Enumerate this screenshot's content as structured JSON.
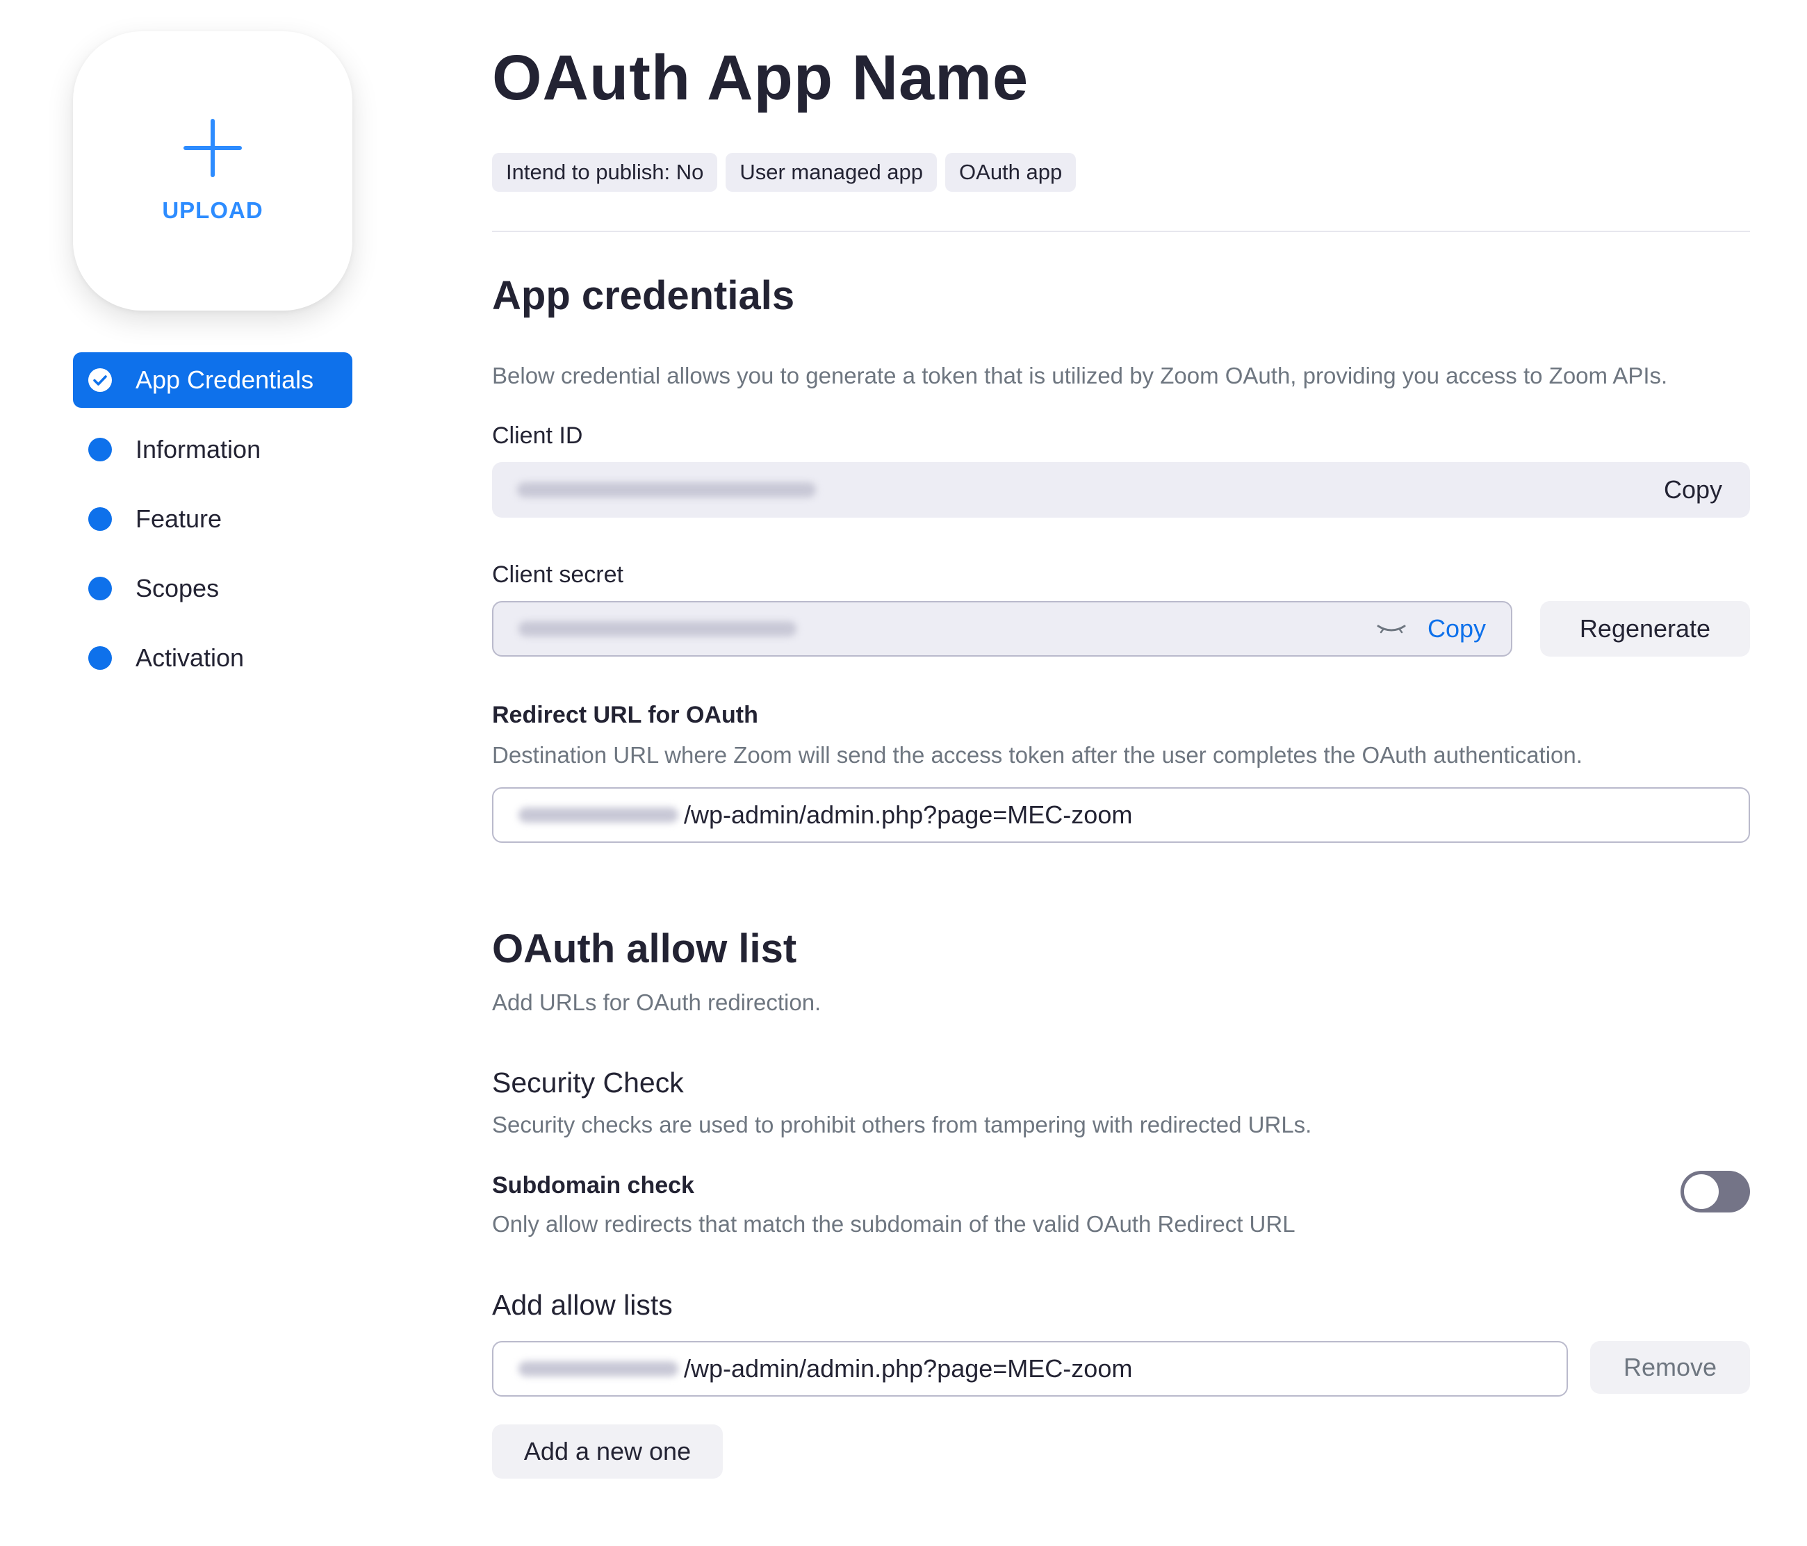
{
  "sidebar": {
    "upload_label": "UPLOAD",
    "items": [
      {
        "label": "App Credentials",
        "active": true
      },
      {
        "label": "Information",
        "active": false
      },
      {
        "label": "Feature",
        "active": false
      },
      {
        "label": "Scopes",
        "active": false
      },
      {
        "label": "Activation",
        "active": false
      }
    ]
  },
  "header": {
    "title": "OAuth App Name",
    "tags": [
      "Intend to publish: No",
      "User managed app",
      "OAuth app"
    ]
  },
  "credentials": {
    "heading": "App credentials",
    "description": "Below credential allows you to generate a token that is utilized by Zoom OAuth, providing you access to Zoom APIs.",
    "client_id_label": "Client ID",
    "client_id_copy": "Copy",
    "client_secret_label": "Client secret",
    "client_secret_copy": "Copy",
    "regenerate_label": "Regenerate",
    "redirect_label": "Redirect URL for OAuth",
    "redirect_description": "Destination URL where Zoom will send the access token after the user completes the OAuth authentication.",
    "redirect_url_path": "/wp-admin/admin.php?page=MEC-zoom"
  },
  "allow_list": {
    "heading": "OAuth allow list",
    "description": "Add URLs for OAuth redirection.",
    "security_heading": "Security Check",
    "security_description": "Security checks are used to prohibit others from tampering with redirected URLs.",
    "subdomain_label": "Subdomain check",
    "subdomain_description": "Only allow redirects that match the subdomain of the valid OAuth Redirect URL",
    "subdomain_enabled": false,
    "add_lists_heading": "Add allow lists",
    "entry_url_path": "/wp-admin/admin.php?page=MEC-zoom",
    "remove_label": "Remove",
    "add_new_label": "Add a new one"
  },
  "colors": {
    "accent": "#0e71eb",
    "upload_blue": "#2d8cff",
    "toggle_off": "#747487"
  },
  "icons": [
    "plus-icon",
    "check-circle-icon",
    "nav-dot-icon",
    "eye-closed-icon"
  ]
}
